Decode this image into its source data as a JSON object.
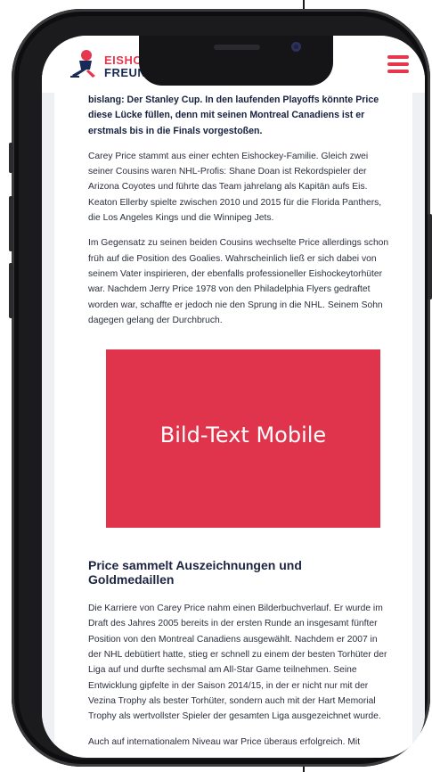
{
  "header": {
    "logo_top": "EISHOCKEY",
    "logo_bottom": "FREUNDE",
    "menu_icon": "hamburger-menu-icon",
    "brand_color": "#e5384f",
    "navy_color": "#1a2a57"
  },
  "article": {
    "lead_text": "bislang: Der Stanley Cup. In den laufenden Playoffs könnte Price diese Lücke füllen, denn mit seinen Montreal Canadiens ist er erstmals bis in die Finals vorgestoßen.",
    "paragraph_1": "Carey Price stammt aus einer echten Eishockey-Familie. Gleich zwei seiner Cousins waren NHL-Profis: Shane Doan ist Rekordspieler der Arizona Coyotes und führte das Team jahrelang als Kapitän aufs Eis. Keaton Ellerby spielte zwischen 2010 und 2015 für die Florida Panthers, die Los Angeles Kings und die Winnipeg Jets.",
    "paragraph_2": "Im Gegensatz zu seinen beiden Cousins wechselte Price allerdings schon früh auf die Position des Goalies. Wahrscheinlich ließ er sich dabei von seinem Vater inspirieren, der ebenfalls professioneller Eishockeytorhüter war. Nachdem Jerry Price 1978 von den Philadelphia Flyers gedraftet worden war, schaffte er jedoch nie den Sprung in die NHL. Seinem Sohn dagegen gelang der Durchbruch.",
    "image_label": "Bild-Text Mobile",
    "image_color": "#e0344d",
    "section_heading": "Price sammelt Auszeichnungen und Goldmedaillen",
    "paragraph_3": "Die Karriere von Carey Price nahm einen Bilderbuchverlauf. Er wurde im Draft des Jahres 2005 bereits in der ersten Runde an insgesamt fünfter Position von den Montreal Canadiens ausgewählt. Nachdem er 2007 in der NHL debütiert hatte, stieg er schnell zu einem der besten Torhüter der Liga auf und durfte sechsmal am All-Star Game teilnehmen. Seine Entwicklung gipfelte in der Saison 2014/15, in der er nicht nur mit der Vezina Trophy als bester Torhüter, sondern auch mit der Hart Memorial Trophy als wertvollster Spieler der gesamten Liga ausgezeichnet wurde.",
    "paragraph_4": "Auch auf internationalem Niveau war Price überaus erfolgreich. Mit"
  }
}
